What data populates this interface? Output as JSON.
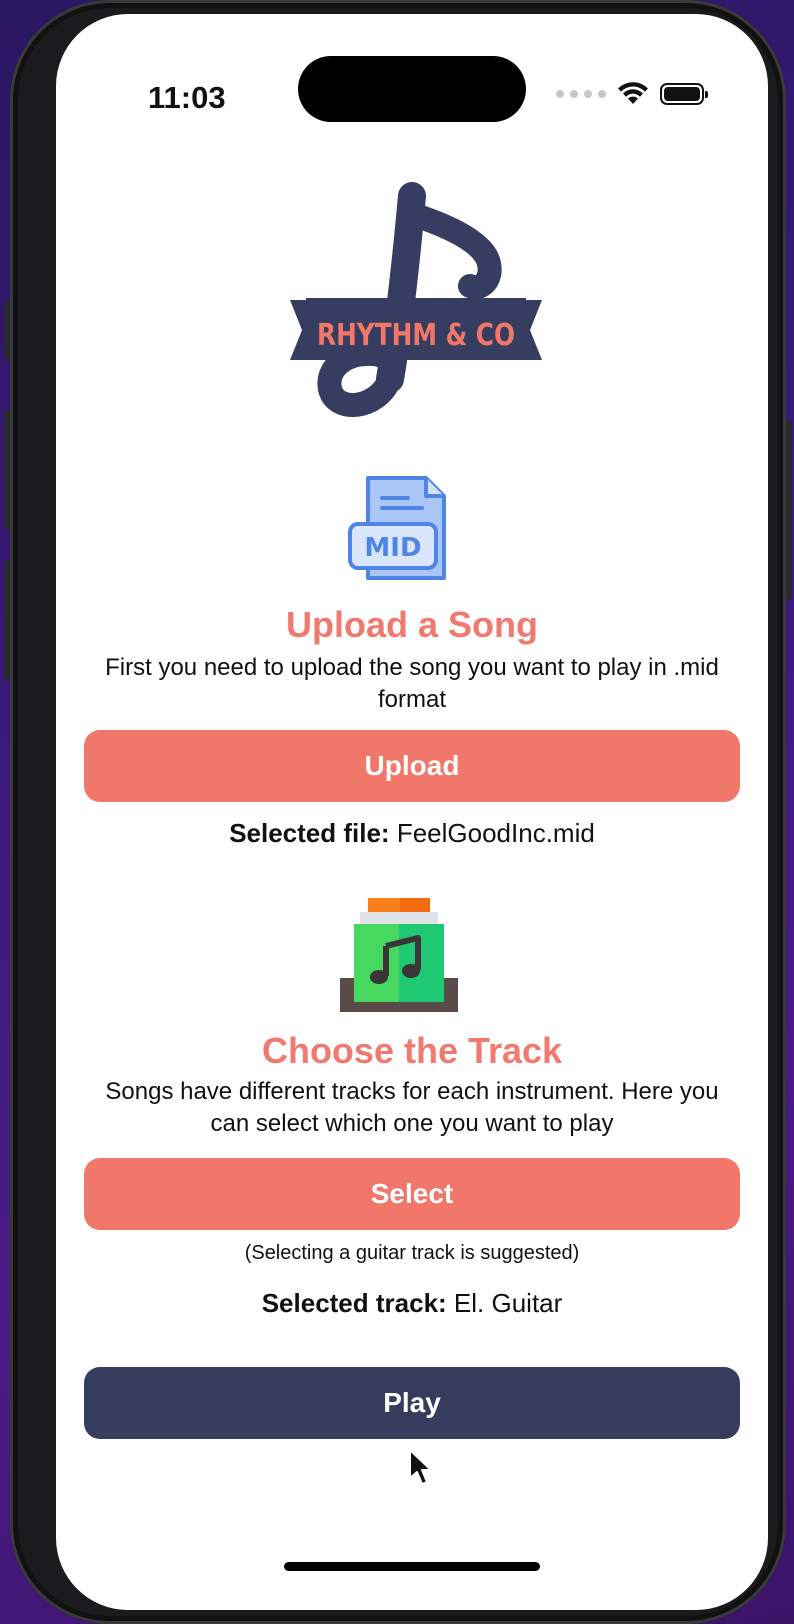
{
  "status_bar": {
    "time": "11:03"
  },
  "logo": {
    "text": "RHYTHM & CO"
  },
  "upload_section": {
    "icon_text": "MID",
    "title": "Upload a Song",
    "description": "First you need to upload the song you want to play in .mid format",
    "button_label": "Upload",
    "selected_label": "Selected file:",
    "selected_value": "FeelGoodInc.mid"
  },
  "track_section": {
    "title": "Choose the Track",
    "description": "Songs have different tracks for each instrument. Here you can select which one you want to play",
    "button_label": "Select",
    "hint": "(Selecting a guitar track is suggested)",
    "selected_label": "Selected track:",
    "selected_value": "El. Guitar"
  },
  "play_button": {
    "label": "Play"
  },
  "colors": {
    "accent": "#f2776b",
    "primary": "#353c5e",
    "heading": "#f07a70"
  }
}
